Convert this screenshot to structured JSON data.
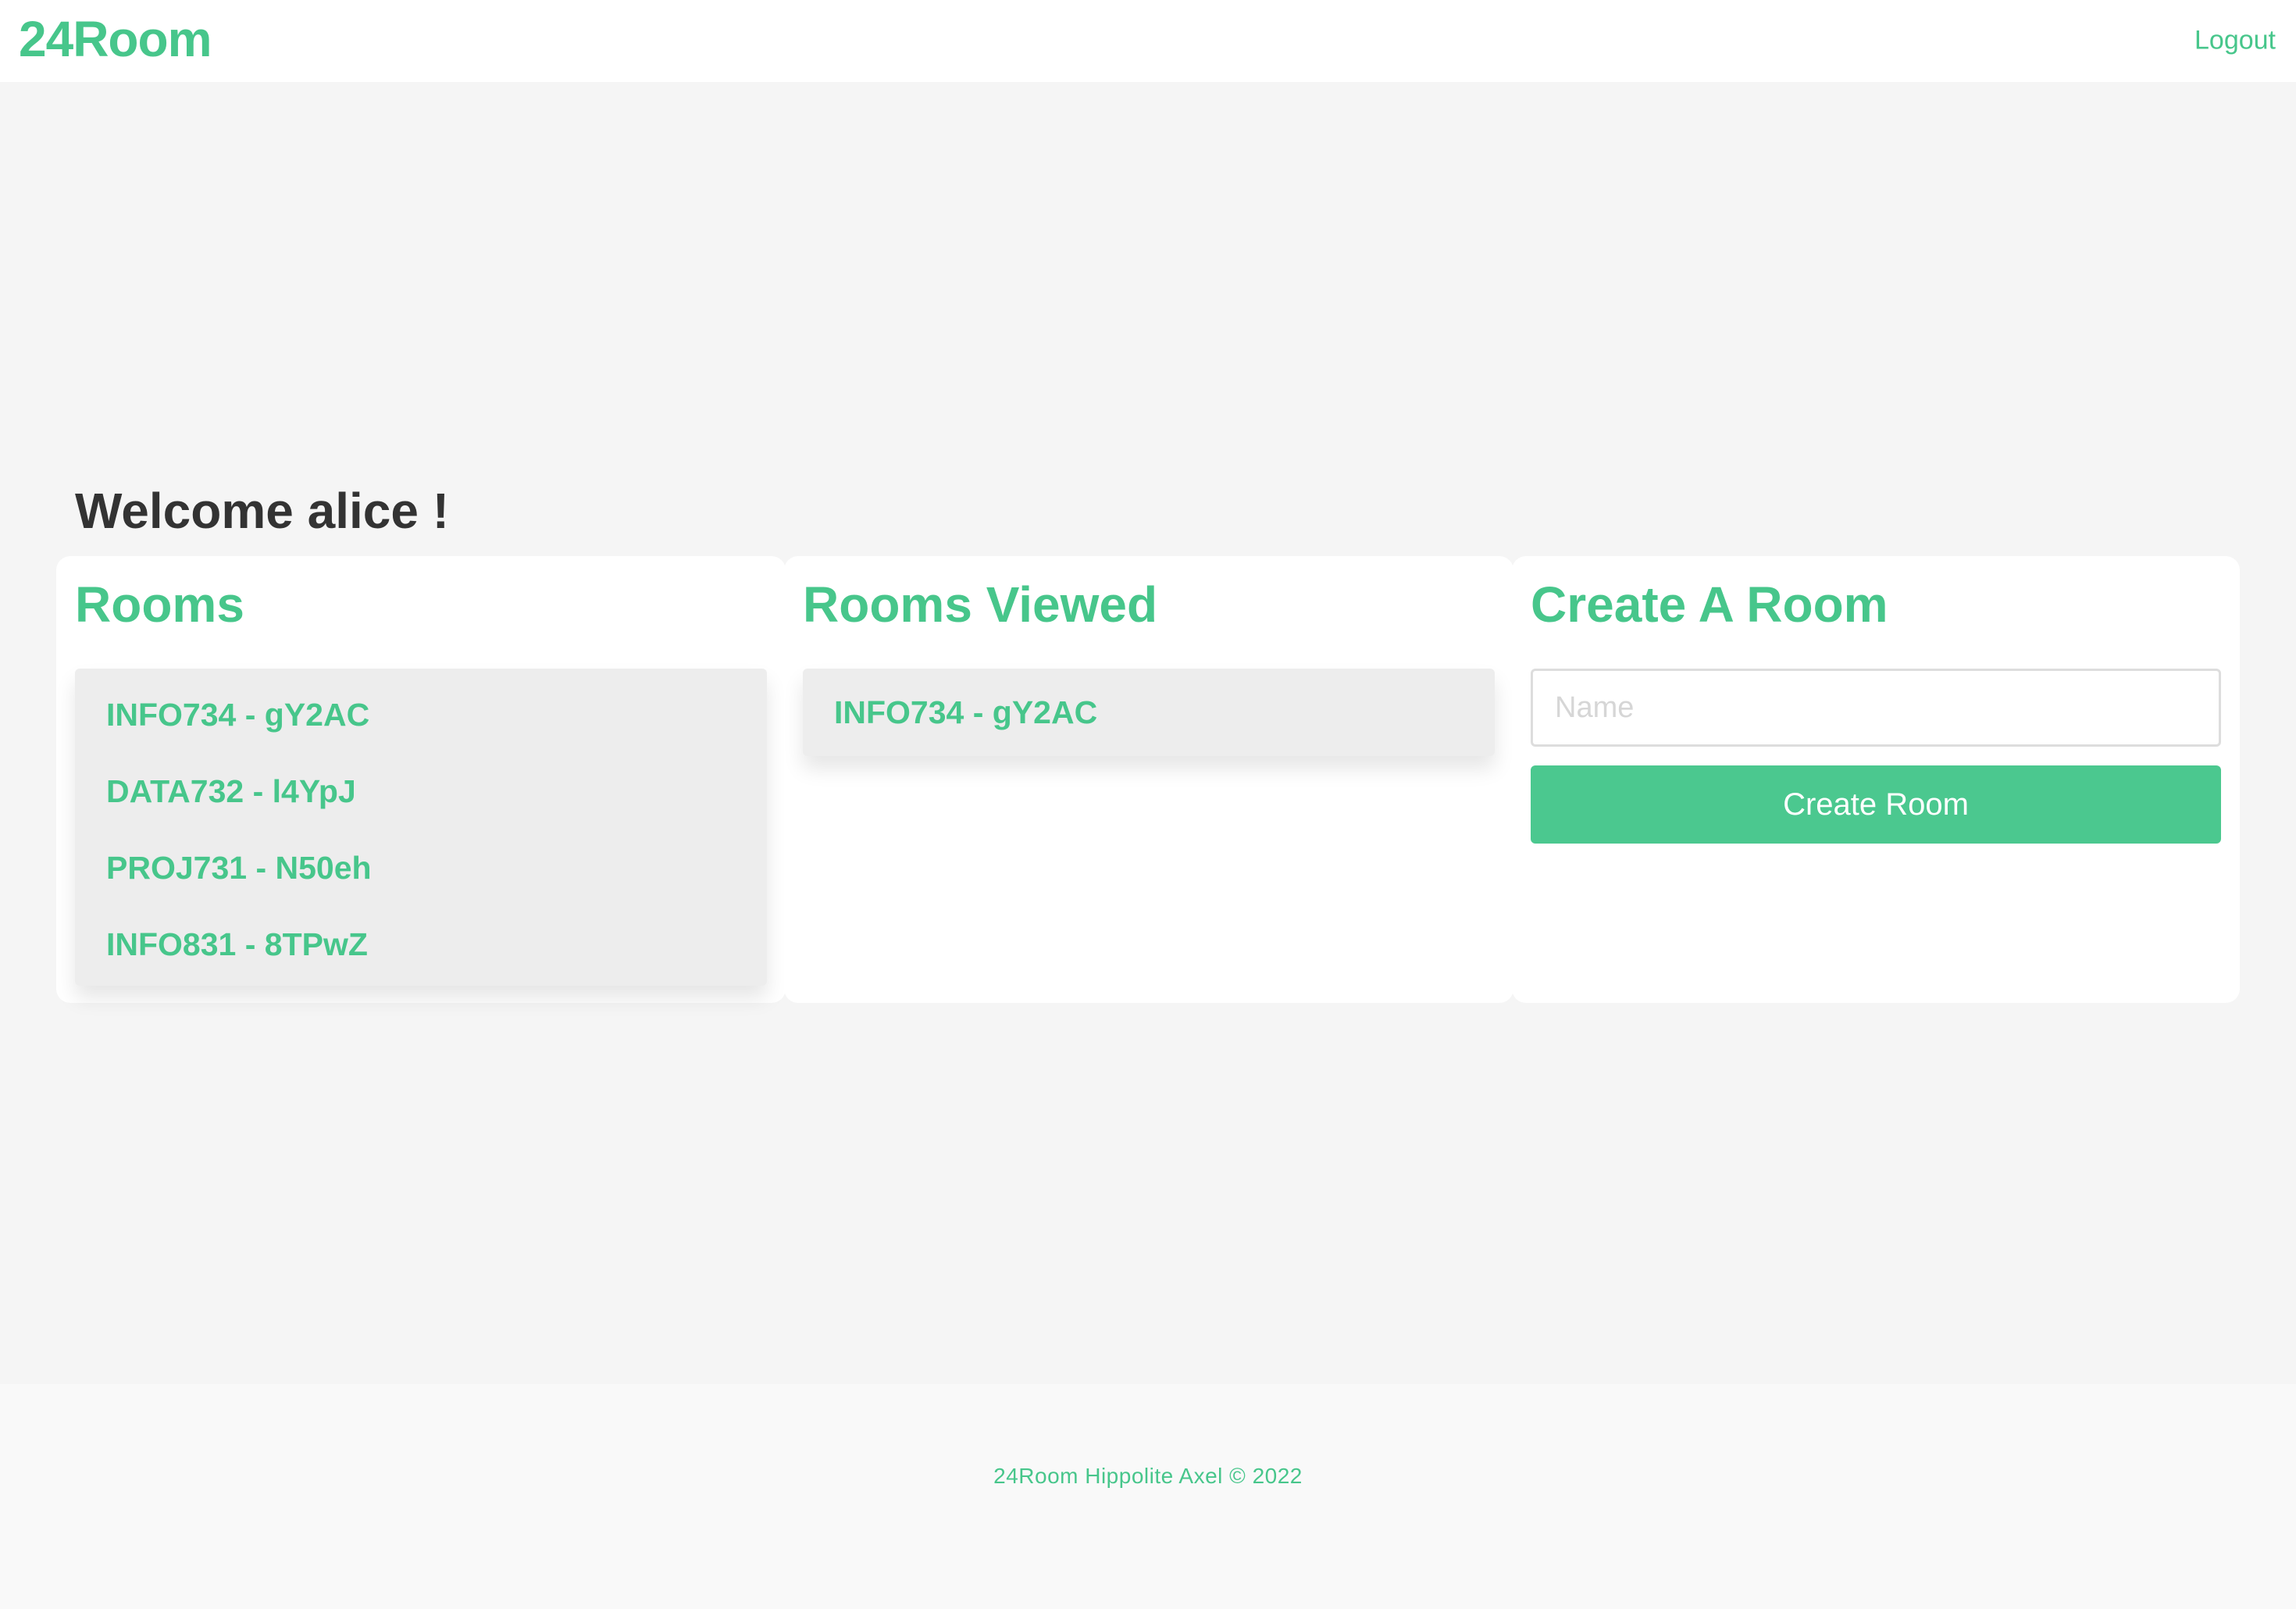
{
  "navbar": {
    "brand": "24Room",
    "logout_label": "Logout"
  },
  "welcome": "Welcome alice !",
  "rooms": {
    "title": "Rooms",
    "items": [
      {
        "label": "INFO734 - gY2AC"
      },
      {
        "label": "DATA732 - l4YpJ"
      },
      {
        "label": "PROJ731 - N50eh"
      },
      {
        "label": "INFO831 - 8TPwZ"
      }
    ]
  },
  "rooms_viewed": {
    "title": "Rooms Viewed",
    "items": [
      {
        "label": "INFO734 - gY2AC"
      }
    ]
  },
  "create_room": {
    "title": "Create A Room",
    "name_value": "",
    "name_placeholder": "Name",
    "button_label": "Create Room"
  },
  "footer": {
    "text": "24Room Hippolite Axel © 2022"
  },
  "colors": {
    "accent": "#47c68b",
    "button": "#4bc88f",
    "background": "#f5f5f5",
    "card": "#ffffff",
    "list": "#ededed",
    "heading": "#333333"
  }
}
